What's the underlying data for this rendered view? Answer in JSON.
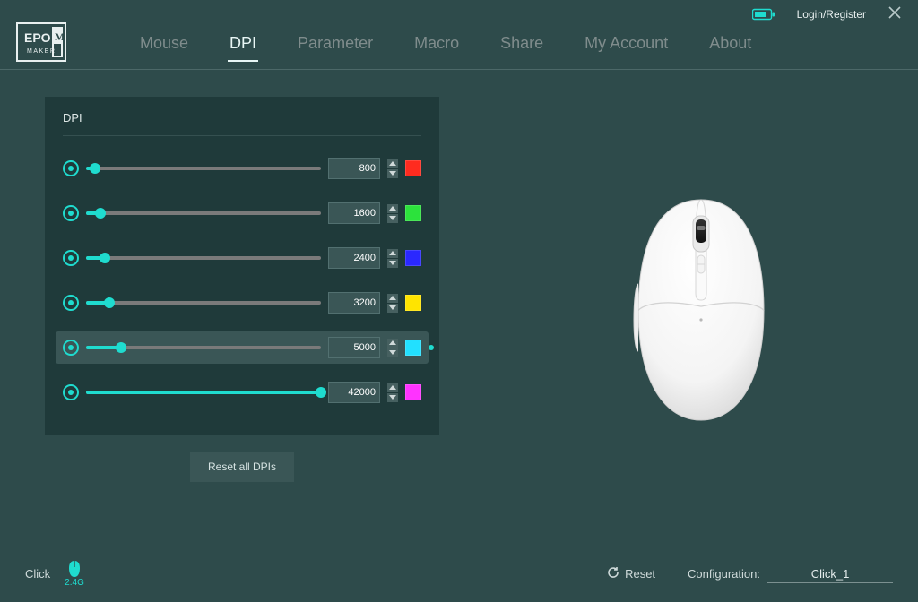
{
  "header": {
    "login_label": "Login/Register"
  },
  "nav": {
    "items": [
      {
        "label": "Mouse",
        "active": false
      },
      {
        "label": "DPI",
        "active": true
      },
      {
        "label": "Parameter",
        "active": false
      },
      {
        "label": "Macro",
        "active": false
      },
      {
        "label": "Share",
        "active": false
      },
      {
        "label": "My Account",
        "active": false
      },
      {
        "label": "About",
        "active": false
      }
    ]
  },
  "panel": {
    "title": "DPI",
    "reset_label": "Reset all DPIs",
    "max_dpi": 42000,
    "active_index": 4,
    "rows": [
      {
        "value": 800,
        "color": "#ff2b1f",
        "pct": 4
      },
      {
        "value": 1600,
        "color": "#2ce23c",
        "pct": 6
      },
      {
        "value": 2400,
        "color": "#2a28ff",
        "pct": 8
      },
      {
        "value": 3200,
        "color": "#ffe400",
        "pct": 10
      },
      {
        "value": 5000,
        "color": "#22e0ff",
        "pct": 15
      },
      {
        "value": 42000,
        "color": "#ff33ff",
        "pct": 100
      }
    ]
  },
  "footer": {
    "click_label": "Click",
    "conn_label": "2.4G",
    "reset_label": "Reset",
    "config_label": "Configuration:",
    "config_value": "Click_1"
  }
}
